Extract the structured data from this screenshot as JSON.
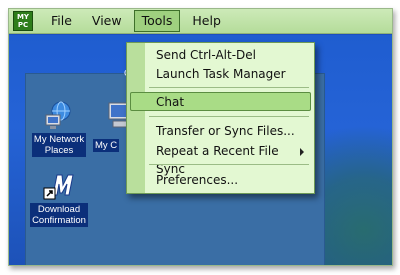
{
  "app": {
    "logo_text_1": "MY",
    "logo_text_2": "PC"
  },
  "menubar": {
    "items": [
      "File",
      "View",
      "Tools",
      "Help"
    ],
    "active": "Tools"
  },
  "desktop": {
    "icons": [
      {
        "label_1": "My Network",
        "label_2": "Places",
        "icon": "network-places-icon"
      },
      {
        "label_1": "My C",
        "icon": "computer-icon"
      },
      {
        "label_1": "Download",
        "label_2": "Confirmation",
        "icon": "shortcut-m-icon"
      }
    ],
    "corner_label": "C"
  },
  "dropdown": {
    "items": [
      {
        "label": "Send Ctrl-Alt-Del"
      },
      {
        "label": "Launch Task Manager"
      },
      {
        "label": "Chat"
      },
      {
        "label": "Transfer or Sync Files..."
      },
      {
        "label": "Repeat a Recent File Sync"
      },
      {
        "label": "Preferences..."
      }
    ],
    "highlighted": "Chat"
  },
  "colors": {
    "menubar": "#b5dc9a",
    "menu_bg": "#e3f8d2",
    "highlight": "#a9dc86",
    "desktop": "#1f5dd0"
  }
}
